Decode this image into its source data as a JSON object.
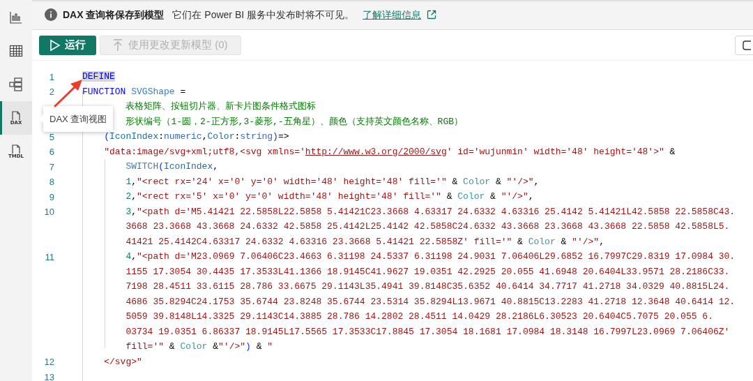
{
  "sidebar": {
    "items": [
      {
        "kind": "bar-chart",
        "selected": false
      },
      {
        "kind": "table",
        "selected": false
      },
      {
        "kind": "model",
        "selected": false
      },
      {
        "kind": "file",
        "label": "DAX",
        "selected": true
      },
      {
        "kind": "file",
        "label": "TMDL",
        "selected": false
      }
    ]
  },
  "info_bar": {
    "title": "DAX 查询将保存到模型",
    "message": "它们在 Power BI 服务中发布时将不可见。",
    "link": "了解详细信息"
  },
  "toolbar": {
    "buttons": [
      {
        "kind": "run",
        "label": "运行",
        "disabled": false
      },
      {
        "kind": "update",
        "label": "使用更改更新模型 (0)",
        "disabled": true
      },
      {
        "kind": "icon",
        "disabled": false
      }
    ]
  },
  "tooltip": {
    "text": "DAX 查询视图"
  },
  "annotation": {
    "kind": "arrow"
  },
  "editor": {
    "lines": [
      {
        "number": "1",
        "rows": [
          {
            "kind": "top",
            "tokens": [
              {
                "kind": "kw",
                "text": "DEFINE",
                "highlighted": true
              }
            ]
          }
        ]
      },
      {
        "number": "2",
        "rows": [
          {
            "kind": "top",
            "tokens": [
              {
                "kind": "kw",
                "text": "FUNCTION"
              },
              {
                "kind": "fn",
                "text": " SVGShape"
              },
              {
                "kind": "plain",
                "text": " ="
              }
            ]
          }
        ]
      },
      {
        "rows": [
          {
            "kind": "inner",
            "tokens": [
              {
                "kind": "comment",
                "text": "表格矩阵、按钮切片器、新卡片图条件格式图标"
              }
            ]
          }
        ]
      },
      {
        "rows": [
          {
            "kind": "inner",
            "tokens": [
              {
                "kind": "comment",
                "text": "形状编号（1-圆，2-正方形,3-菱形,-五角星）、颜色（支持英文颜色名称、RGB）"
              }
            ]
          }
        ]
      },
      {
        "number": "5",
        "rows": [
          {
            "kind": "block",
            "tokens": [
              {
                "kind": "paren",
                "text": "("
              },
              {
                "kind": "param",
                "text": "IconIndex"
              },
              {
                "kind": "plain",
                "text": ":"
              },
              {
                "kind": "type",
                "text": "numeric"
              },
              {
                "kind": "plain",
                "text": ","
              },
              {
                "kind": "param",
                "text": "Color"
              },
              {
                "kind": "plain",
                "text": ":"
              },
              {
                "kind": "type",
                "text": "string"
              },
              {
                "kind": "paren",
                "text": ")"
              },
              {
                "kind": "plain",
                "text": "=>"
              }
            ]
          }
        ]
      },
      {
        "number": "6",
        "rows": [
          {
            "kind": "block",
            "tokens": [
              {
                "kind": "str",
                "text": "\"data:image/svg+xml;utf8,<svg xmlns='"
              },
              {
                "kind": "url",
                "text": "http://www.w3.org/2000/svg"
              },
              {
                "kind": "str",
                "text": "' id='wujunmin' width='48' height='48'>\""
              },
              {
                "kind": "plain",
                "text": " &"
              }
            ]
          }
        ]
      },
      {
        "number": "7",
        "rows": [
          {
            "kind": "inner",
            "tokens": [
              {
                "kind": "fn",
                "text": "SWITCH"
              },
              {
                "kind": "paren",
                "text": "("
              },
              {
                "kind": "param",
                "text": "IconIndex"
              },
              {
                "kind": "plain",
                "text": ","
              }
            ]
          }
        ]
      },
      {
        "number": "8",
        "rows": [
          {
            "kind": "inner",
            "tokens": [
              {
                "kind": "num",
                "text": "1"
              },
              {
                "kind": "plain",
                "text": ","
              },
              {
                "kind": "str",
                "text": "\"<rect rx='24' x='0' y='0' width='48' height='48' fill='\""
              },
              {
                "kind": "plain",
                "text": " & "
              },
              {
                "kind": "color",
                "text": "Color"
              },
              {
                "kind": "plain",
                "text": " & "
              },
              {
                "kind": "str",
                "text": "\"'/>\""
              },
              {
                "kind": "plain",
                "text": ","
              }
            ]
          }
        ]
      },
      {
        "number": "9",
        "rows": [
          {
            "kind": "inner",
            "tokens": [
              {
                "kind": "num",
                "text": "2"
              },
              {
                "kind": "plain",
                "text": ","
              },
              {
                "kind": "str",
                "text": "\"<rect rx='5' x='0' y='0' width='48' height='48' fill='\""
              },
              {
                "kind": "plain",
                "text": " & "
              },
              {
                "kind": "color",
                "text": "Color"
              },
              {
                "kind": "plain",
                "text": " & "
              },
              {
                "kind": "str",
                "text": "\"'/>\""
              },
              {
                "kind": "plain",
                "text": ","
              }
            ]
          }
        ]
      },
      {
        "number": "10",
        "rows": [
          {
            "kind": "inner",
            "tokens": [
              {
                "kind": "num",
                "text": "3"
              },
              {
                "kind": "plain",
                "text": ","
              },
              {
                "kind": "str",
                "text": "\"<path d='M5.41421 22.5858L22.5858 5.41421C23.3668 4.63317 24.6332 4.63316 25.4142 5.41421L42.5858 22.5858C43."
              }
            ]
          },
          {
            "kind": "inner",
            "tokens": [
              {
                "kind": "str",
                "text": "3668 23.3668 43.3668 24.6332 42.5858 25.4142L25.4142 42.5858C24.6332 43.3668 23.3668 43.3668 22.5858 42.5858L5."
              }
            ]
          },
          {
            "kind": "inner",
            "tokens": [
              {
                "kind": "str",
                "text": "41421 25.4142C4.63317 24.6332 4.63316 23.3668 5.41421 22.5858Z' fill='\""
              },
              {
                "kind": "plain",
                "text": " & "
              },
              {
                "kind": "color",
                "text": "Color"
              },
              {
                "kind": "plain",
                "text": " & "
              },
              {
                "kind": "str",
                "text": "\"'/>\""
              },
              {
                "kind": "plain",
                "text": ","
              }
            ]
          }
        ]
      },
      {
        "number": "11",
        "rows": [
          {
            "kind": "inner",
            "tokens": [
              {
                "kind": "num",
                "text": "4"
              },
              {
                "kind": "plain",
                "text": ","
              },
              {
                "kind": "str",
                "text": "\"<path d='M23.0969 7.06406C23.4663 6.31198 24.5337 6.31198 24.9031 7.06406L29.6852 16.7997C29.8319 17.0984 30."
              }
            ]
          },
          {
            "kind": "inner",
            "tokens": [
              {
                "kind": "str",
                "text": "1155 17.3054 30.4435 17.3533L41.1366 18.9145C41.9627 19.0351 42.2925 20.055 41.6948 20.6404L33.9571 28.2186C33."
              }
            ]
          },
          {
            "kind": "inner",
            "tokens": [
              {
                "kind": "str",
                "text": "7198 28.4511 33.6115 28.786 33.6675 29.1143L35.4941 39.8148C35.6352 40.6414 34.7717 41.2718 34.0329 40.8815L24."
              }
            ]
          },
          {
            "kind": "inner",
            "tokens": [
              {
                "kind": "str",
                "text": "4686 35.8294C24.1753 35.6744 23.8248 35.6744 23.5314 35.8294L13.9671 40.8815C13.2283 41.2718 12.3648 40.6414 12."
              }
            ]
          },
          {
            "kind": "inner",
            "tokens": [
              {
                "kind": "str",
                "text": "5059 39.8148L14.3325 29.1143C14.3885 28.786 14.2802 28.4511 14.0429 28.2186L6.30523 20.6404C5.7075 20.055 6."
              }
            ]
          },
          {
            "kind": "inner",
            "tokens": [
              {
                "kind": "str",
                "text": "03734 19.0351 6.86337 18.9145L17.5565 17.3533C17.8845 17.3054 18.1681 17.0984 18.3148 16.7997L23.0969 7.06406Z'"
              }
            ]
          },
          {
            "kind": "inner",
            "tokens": [
              {
                "kind": "str",
                "text": "fill='\""
              },
              {
                "kind": "plain",
                "text": " & "
              },
              {
                "kind": "color",
                "text": "Color"
              },
              {
                "kind": "plain",
                "text": " &"
              },
              {
                "kind": "str",
                "text": "\"'/>\""
              },
              {
                "kind": "paren",
                "text": ")"
              },
              {
                "kind": "plain",
                "text": " & "
              },
              {
                "kind": "str",
                "text": "\""
              }
            ]
          }
        ]
      },
      {
        "number": "12",
        "rows": [
          {
            "kind": "block",
            "tokens": [
              {
                "kind": "str",
                "text": "</svg>\""
              }
            ]
          }
        ]
      },
      {
        "number": "13",
        "rows": [
          {
            "kind": "top",
            "tokens": []
          }
        ]
      }
    ]
  }
}
